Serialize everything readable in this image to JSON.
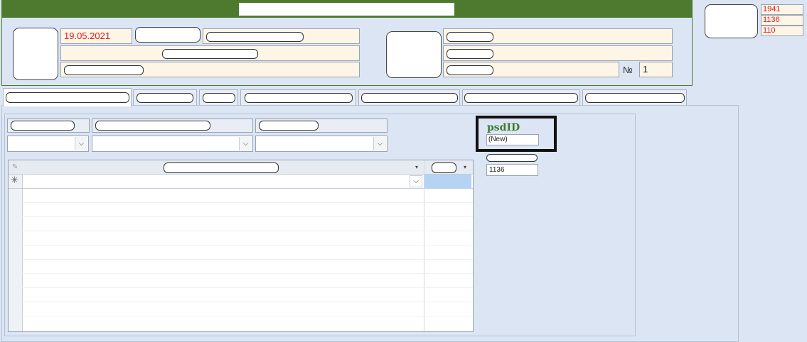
{
  "header": {
    "date": "19.05.2021",
    "number_sign": "№",
    "number_value": "1"
  },
  "side_values": [
    "1941",
    "1136",
    "110"
  ],
  "form": {
    "psd_label": "psdID",
    "psd_value": "(New)",
    "project_id_value": "1136"
  },
  "grid": {
    "new_record_marker": "✳",
    "dropdown_glyph": "▾",
    "combo_glyph": "⌵"
  },
  "icons": {
    "new-record": "asterisk",
    "dropdown": "chevron-down",
    "pencil": "pencil"
  },
  "colors": {
    "header_green": "#4e7a2f",
    "field_bg": "#fdf5e6",
    "red_text": "#e31a1a",
    "label_green": "#3f7a2a",
    "panel_bg": "#dbe5f4",
    "selected_cell": "#b4d3f5"
  }
}
